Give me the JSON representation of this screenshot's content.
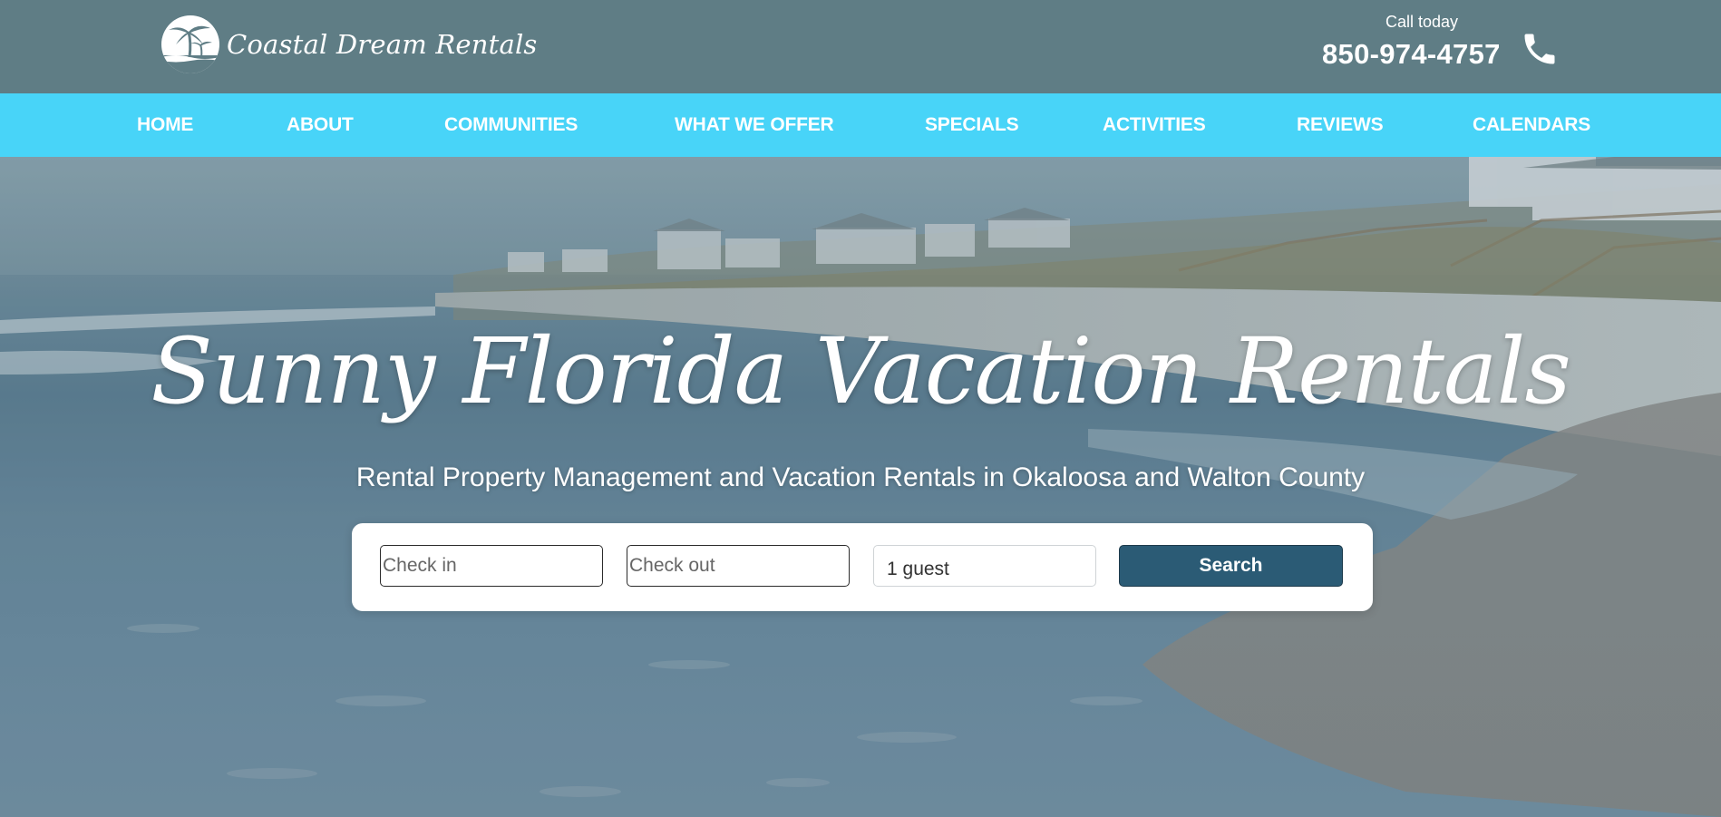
{
  "header": {
    "logo_text": "Coastal Dream Rentals",
    "call_label": "Call today",
    "phone_number": "850-974-4757"
  },
  "nav": {
    "items": [
      "HOME",
      "ABOUT",
      "COMMUNITIES",
      "WHAT WE OFFER",
      "SPECIALS",
      "ACTIVITIES",
      "REVIEWS",
      "CALENDARS"
    ]
  },
  "hero": {
    "title": "Sunny Florida Vacation Rentals",
    "subtitle": "Rental Property Management and Vacation Rentals in Okaloosa and Walton County"
  },
  "search": {
    "checkin_placeholder": "Check in",
    "checkout_placeholder": "Check out",
    "guests_value": "1 guest",
    "button_label": "Search"
  },
  "colors": {
    "header_bg": "#5f7d85",
    "nav_bg": "#48d4f8",
    "button_bg": "#2b5b75"
  },
  "icons": [
    "palm-tree-logo-icon",
    "phone-icon"
  ]
}
